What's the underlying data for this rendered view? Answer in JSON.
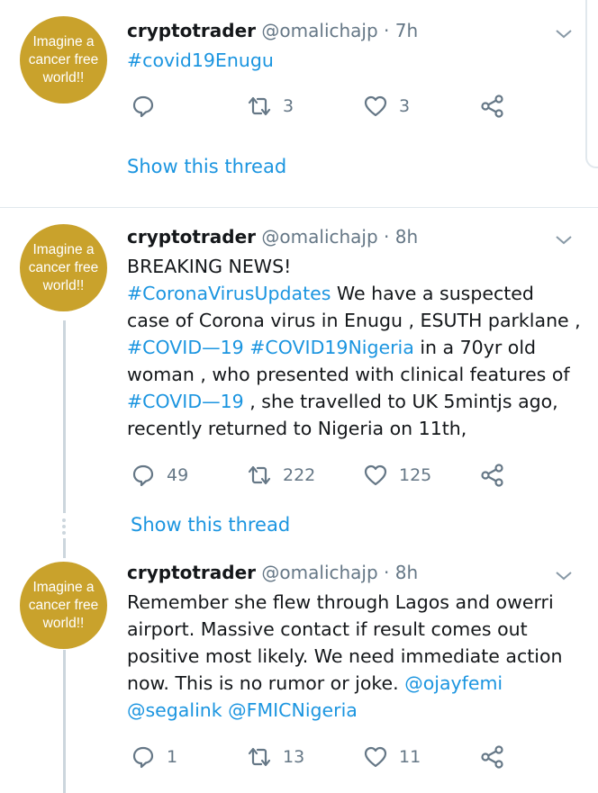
{
  "colors": {
    "link": "#1b95e0",
    "muted": "#657786",
    "avatar_bg": "#c9a22c"
  },
  "tweets": [
    {
      "avatar_text": "Imagine a cancer free world!!",
      "name": "cryptotrader",
      "handle": "@omalichajp",
      "time": "· 7h",
      "lines": [
        [
          {
            "text": "#covid19Enugu",
            "link": true
          }
        ]
      ],
      "reply_count": "",
      "retweet_count": "3",
      "like_count": "3",
      "show_thread": "Show this thread"
    },
    {
      "avatar_text": "Imagine a cancer free world!!",
      "name": "cryptotrader",
      "handle": "@omalichajp",
      "time": "· 8h",
      "lines": [
        [
          {
            "text": "BREAKING NEWS!"
          }
        ],
        [
          {
            "text": " "
          },
          {
            "text": "#CoronaVirusUpdates",
            "link": true
          },
          {
            "text": " We have a suspected"
          }
        ],
        [
          {
            "text": "case of Corona virus in Enugu , ESUTH parklane ,"
          }
        ],
        [
          {
            "text": "#COVID—19",
            "link": true
          },
          {
            "text": " "
          },
          {
            "text": "#COVID19Nigeria",
            "link": true
          },
          {
            "text": " in a 70yr old"
          }
        ],
        [
          {
            "text": "woman , who presented with clinical features of"
          }
        ],
        [
          {
            "text": "#COVID—19",
            "link": true
          },
          {
            "text": " , she travelled to UK 5mintjs ago,"
          }
        ],
        [
          {
            "text": "recently returned to Nigeria on 11th,"
          }
        ]
      ],
      "reply_count": "49",
      "retweet_count": "222",
      "like_count": "125",
      "show_thread": "Show this thread"
    },
    {
      "avatar_text": "Imagine a cancer free world!!",
      "name": "cryptotrader",
      "handle": "@omalichajp",
      "time": "· 8h",
      "lines": [
        [
          {
            "text": "Remember she flew through Lagos and owerri"
          }
        ],
        [
          {
            "text": "airport. Massive contact if result comes out"
          }
        ],
        [
          {
            "text": "positive most likely. We need immediate action"
          }
        ],
        [
          {
            "text": "now. This is no rumor or joke. "
          },
          {
            "text": "@ojayfemi",
            "link": true
          }
        ],
        [
          {
            "text": "@segalink",
            "link": true
          },
          {
            "text": " "
          },
          {
            "text": "@FMICNigeria",
            "link": true
          }
        ]
      ],
      "reply_count": "1",
      "retweet_count": "13",
      "like_count": "11",
      "show_thread": ""
    }
  ]
}
